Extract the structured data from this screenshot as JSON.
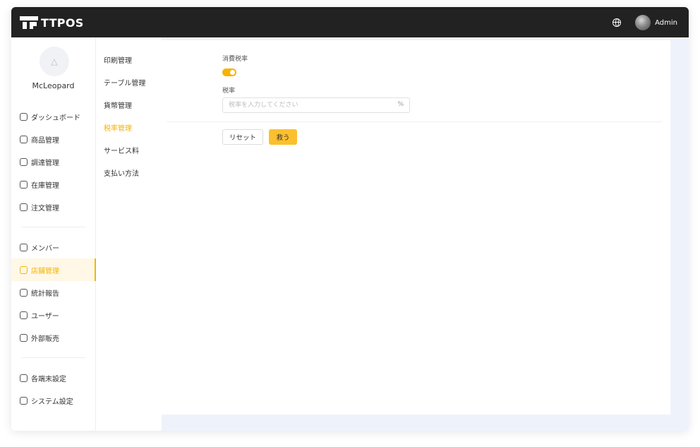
{
  "header": {
    "app_name": "TTPOS",
    "user_name": "Admin",
    "icons": {
      "language": "globe-icon",
      "avatar": "user-avatar"
    }
  },
  "sidebar": {
    "store_name": "McLeopard",
    "avatar_icon": "image-placeholder-icon",
    "groups": [
      [
        {
          "label": "ダッシュボード",
          "icon": "dashboard-icon"
        },
        {
          "label": "商品管理",
          "icon": "product-icon"
        },
        {
          "label": "調達管理",
          "icon": "cart-icon"
        },
        {
          "label": "在庫管理",
          "icon": "inventory-icon"
        },
        {
          "label": "注文管理",
          "icon": "order-icon"
        }
      ],
      [
        {
          "label": "メンバー",
          "icon": "member-icon"
        },
        {
          "label": "店舗管理",
          "icon": "store-icon",
          "active": true
        },
        {
          "label": "統計報告",
          "icon": "report-icon"
        },
        {
          "label": "ユーザー",
          "icon": "users-icon"
        },
        {
          "label": "外部販売",
          "icon": "external-sales-icon"
        }
      ],
      [
        {
          "label": "各端末設定",
          "icon": "terminal-icon"
        },
        {
          "label": "システム設定",
          "icon": "settings-icon"
        }
      ]
    ]
  },
  "submenu": {
    "items": [
      {
        "label": "印刷管理"
      },
      {
        "label": "テーブル管理"
      },
      {
        "label": "貨幣管理"
      },
      {
        "label": "税率管理",
        "active": true
      },
      {
        "label": "サービス料"
      },
      {
        "label": "支払い方法"
      }
    ]
  },
  "form": {
    "consumption_tax_label": "消費税率",
    "consumption_tax_enabled": true,
    "tax_rate_label": "税率",
    "tax_rate_placeholder": "税率を入力してください",
    "tax_rate_value": "",
    "tax_rate_suffix": "%",
    "reset_label": "リセット",
    "save_label": "救う"
  },
  "colors": {
    "accent": "#f5b400",
    "topbar": "#222222",
    "content_bg": "#eef3fb"
  }
}
